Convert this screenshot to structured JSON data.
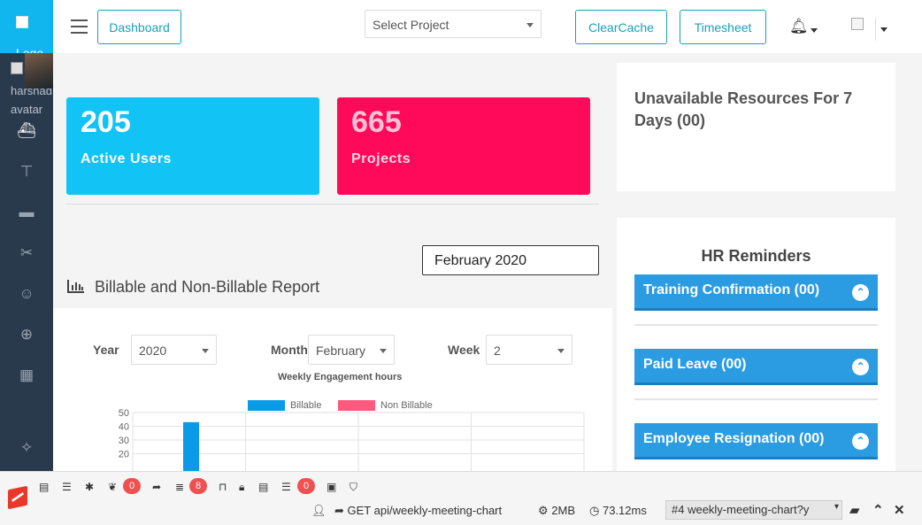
{
  "sidebar": {
    "logo_text": "Logo",
    "user_alt": "harshad avatar"
  },
  "topbar": {
    "dashboard_label": "Dashboard",
    "select_project_placeholder": "Select Project",
    "clear_cache_label": "ClearCache",
    "timesheet_label": "Timesheet"
  },
  "stats": [
    {
      "value": "205",
      "label": "Active Users",
      "color": "#12c3f5"
    },
    {
      "value": "665",
      "label": "Projects",
      "color": "#ff0a5a"
    }
  ],
  "month_picker": {
    "value": "February 2020"
  },
  "report": {
    "title": "Billable and Non-Billable Report",
    "filters": {
      "year_label": "Year",
      "year_value": "2020",
      "month_label": "Month",
      "month_value": "February",
      "week_label": "Week",
      "week_value": "2"
    }
  },
  "chart_data": {
    "type": "bar",
    "title": "Weekly Engagement hours",
    "series": [
      {
        "name": "Billable",
        "color": "#0a9be8",
        "values": [
          43
        ]
      },
      {
        "name": "Non Billable",
        "color": "#ff5a7d",
        "values": [
          0
        ]
      }
    ],
    "yticks": [
      "50",
      "40",
      "30",
      "20"
    ],
    "ylim": [
      0,
      50
    ]
  },
  "right": {
    "unavailable_title": "Unavailable Resources For 7 Days (00)",
    "hr_title": "HR Reminders",
    "accordions": [
      {
        "label": "Training Confirmation (00)"
      },
      {
        "label": "Paid Leave (00)"
      },
      {
        "label": "Employee Resignation (00)"
      }
    ]
  },
  "debugbar": {
    "badge_1": "0",
    "badge_2": "8",
    "badge_3": "0",
    "route": "GET api/weekly-meeting-chart",
    "memory": "2MB",
    "time": "73.12ms",
    "request": "#4 weekly-meeting-chart?y"
  }
}
